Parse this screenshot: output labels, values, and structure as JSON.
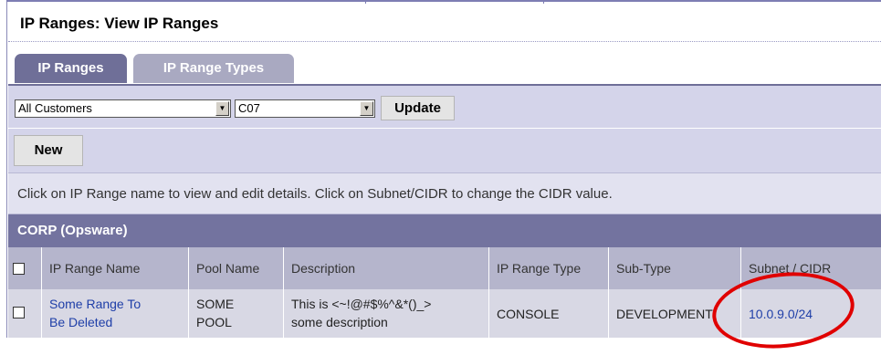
{
  "page": {
    "title": "IP Ranges: View IP Ranges"
  },
  "tabs": [
    {
      "label": "IP Ranges",
      "active": true
    },
    {
      "label": "IP Range Types",
      "active": false
    }
  ],
  "filters": {
    "customer": "All Customers",
    "facility": "C07",
    "update_label": "Update"
  },
  "actions": {
    "new_label": "New"
  },
  "info_text": "Click on IP Range name to view and edit details. Click on Subnet/CIDR to change the CIDR value.",
  "group": {
    "name": "CORP (Opsware)"
  },
  "table": {
    "columns": [
      "IP Range Name",
      "Pool Name",
      "Description",
      "IP Range Type",
      "Sub-Type",
      "Subnet / CIDR"
    ],
    "rows": [
      {
        "name_line1": "Some Range To",
        "name_line2": "Be Deleted",
        "pool_line1": "SOME",
        "pool_line2": "POOL",
        "desc_line1": "This is <~!@#$%^&*()_>",
        "desc_line2": "some description",
        "type": "CONSOLE",
        "subtype": "DEVELOPMENT",
        "cidr": "10.0.9.0/24"
      }
    ]
  },
  "colors": {
    "accent": "#6f6f98",
    "link": "#1f3fa8",
    "annotation": "#e00000"
  }
}
